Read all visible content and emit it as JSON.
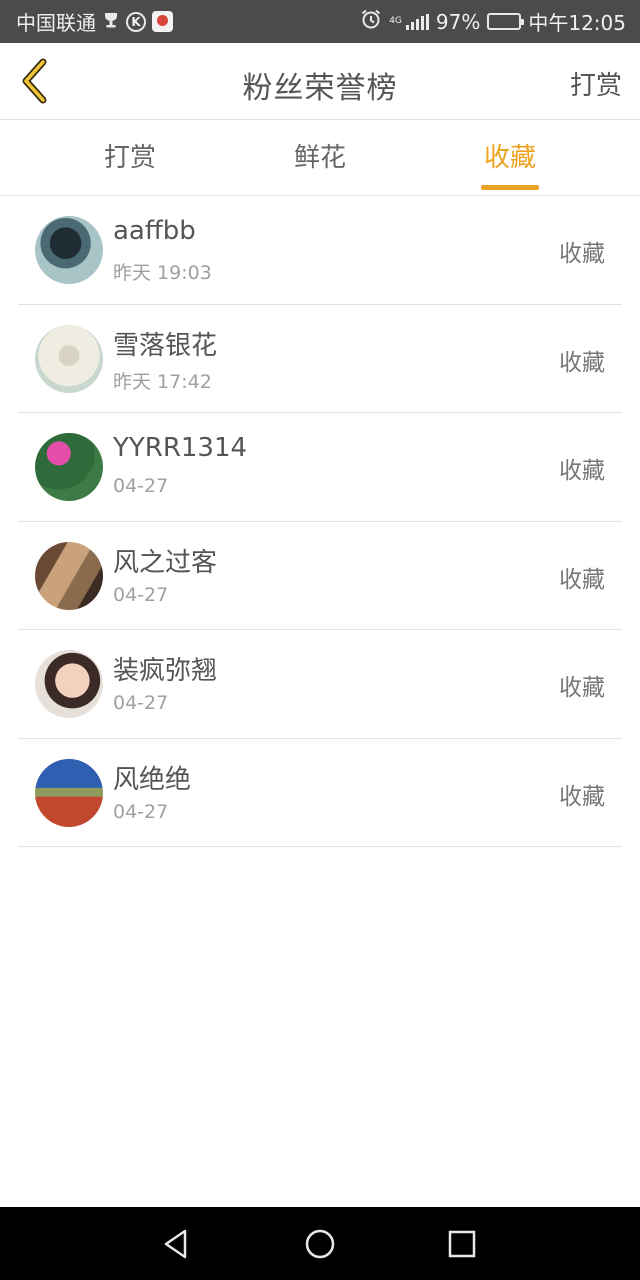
{
  "status_bar": {
    "carrier": "中国联通",
    "network": "4G",
    "battery": "97%",
    "time": "中午12:05",
    "k_badge": "K"
  },
  "header": {
    "title": "粉丝荣誉榜",
    "right_action": "打赏"
  },
  "tabs": [
    {
      "label": "打赏",
      "active": false
    },
    {
      "label": "鲜花",
      "active": false
    },
    {
      "label": "收藏",
      "active": true
    }
  ],
  "accent_color": "#eda321",
  "rows": [
    {
      "name": "aaffbb",
      "time": "昨天 19:03",
      "action": "收藏"
    },
    {
      "name": "雪落银花",
      "time": "昨天 17:42",
      "action": "收藏"
    },
    {
      "name": "YYRR1314",
      "time": "04-27",
      "action": "收藏"
    },
    {
      "name": "风之过客",
      "time": "04-27",
      "action": "收藏"
    },
    {
      "name": "装疯弥翘",
      "time": "04-27",
      "action": "收藏"
    },
    {
      "name": "风绝绝",
      "time": "04-27",
      "action": "收藏"
    }
  ],
  "nav": {
    "icons": [
      "back-triangle-icon",
      "home-circle-icon",
      "recents-square-icon"
    ]
  }
}
